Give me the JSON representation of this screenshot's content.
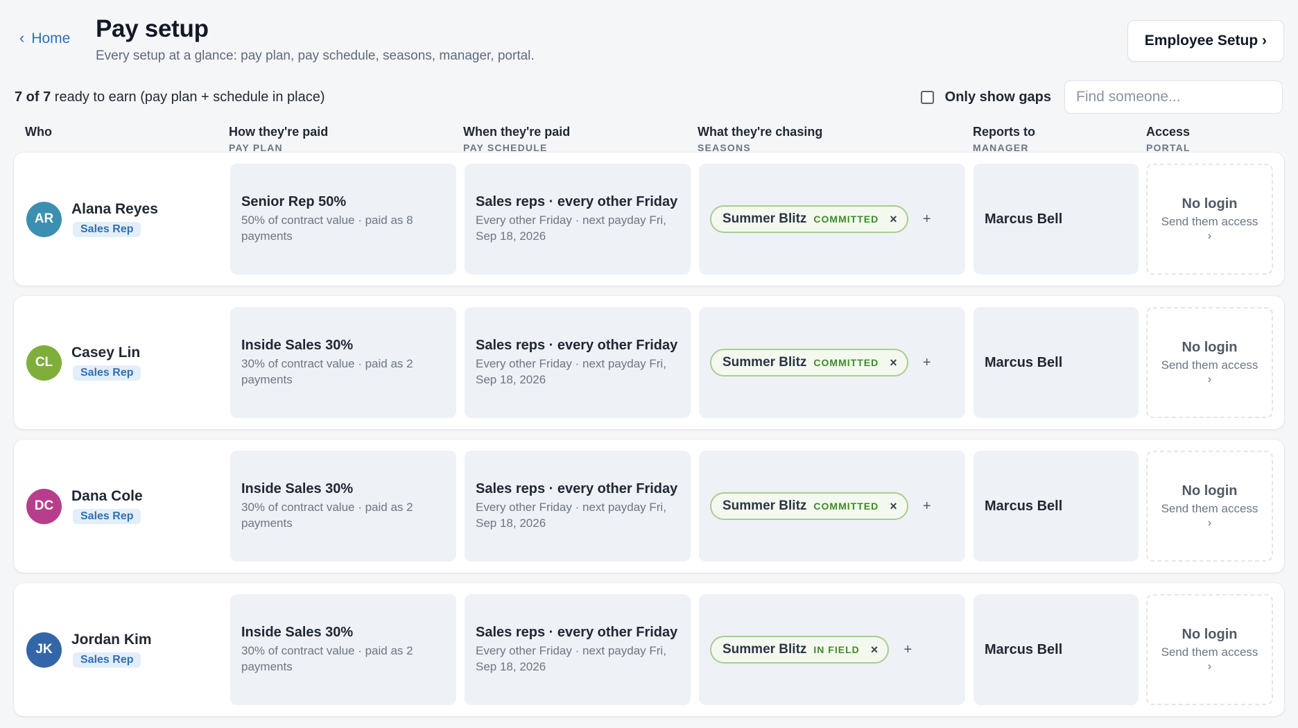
{
  "header": {
    "home_label": "Home",
    "title": "Pay setup",
    "subtitle": "Every setup at a glance: pay plan, pay schedule, seasons, manager, portal.",
    "setup_button": "Employee Setup ›"
  },
  "toolbar": {
    "ready_count": "7 of 7",
    "ready_rest": " ready to earn (pay plan + schedule in place)",
    "gaps_label": "Only show gaps",
    "gaps_checked": false,
    "search_placeholder": "Find someone..."
  },
  "columns": [
    {
      "main": "Who",
      "sub": ""
    },
    {
      "main": "How they're paid",
      "sub": "PAY PLAN"
    },
    {
      "main": "When they're paid",
      "sub": "PAY SCHEDULE"
    },
    {
      "main": "What they're chasing",
      "sub": "SEASONS"
    },
    {
      "main": "Reports to",
      "sub": "MANAGER"
    },
    {
      "main": "Access",
      "sub": "PORTAL"
    }
  ],
  "people": [
    {
      "initials": "AR",
      "name": "Alana Reyes",
      "role": "Sales Rep",
      "avatar_color": "#3b8fb0",
      "plan_title": "Senior Rep 50%",
      "plan_desc": "50% of contract value · paid as 8 payments",
      "sched_title": "Sales reps · every other Friday",
      "sched_desc": "Every other Friday · next payday Fri, Sep 18, 2026",
      "season_name": "Summer Blitz",
      "season_status": "COMMITTED",
      "manager": "Marcus Bell",
      "portal_title": "No login",
      "portal_link": "Send them access ›"
    },
    {
      "initials": "CL",
      "name": "Casey Lin",
      "role": "Sales Rep",
      "avatar_color": "#7fae3a",
      "plan_title": "Inside Sales 30%",
      "plan_desc": "30% of contract value · paid as 2 payments",
      "sched_title": "Sales reps · every other Friday",
      "sched_desc": "Every other Friday · next payday Fri, Sep 18, 2026",
      "season_name": "Summer Blitz",
      "season_status": "COMMITTED",
      "manager": "Marcus Bell",
      "portal_title": "No login",
      "portal_link": "Send them access ›"
    },
    {
      "initials": "DC",
      "name": "Dana Cole",
      "role": "Sales Rep",
      "avatar_color": "#b63e8c",
      "plan_title": "Inside Sales 30%",
      "plan_desc": "30% of contract value · paid as 2 payments",
      "sched_title": "Sales reps · every other Friday",
      "sched_desc": "Every other Friday · next payday Fri, Sep 18, 2026",
      "season_name": "Summer Blitz",
      "season_status": "COMMITTED",
      "manager": "Marcus Bell",
      "portal_title": "No login",
      "portal_link": "Send them access ›"
    },
    {
      "initials": "JK",
      "name": "Jordan Kim",
      "role": "Sales Rep",
      "avatar_color": "#3366a8",
      "plan_title": "Inside Sales 30%",
      "plan_desc": "30% of contract value · paid as 2 payments",
      "sched_title": "Sales reps · every other Friday",
      "sched_desc": "Every other Friday · next payday Fri, Sep 18, 2026",
      "season_name": "Summer Blitz",
      "season_status": "IN FIELD",
      "manager": "Marcus Bell",
      "portal_title": "No login",
      "portal_link": "Send them access ›"
    }
  ]
}
